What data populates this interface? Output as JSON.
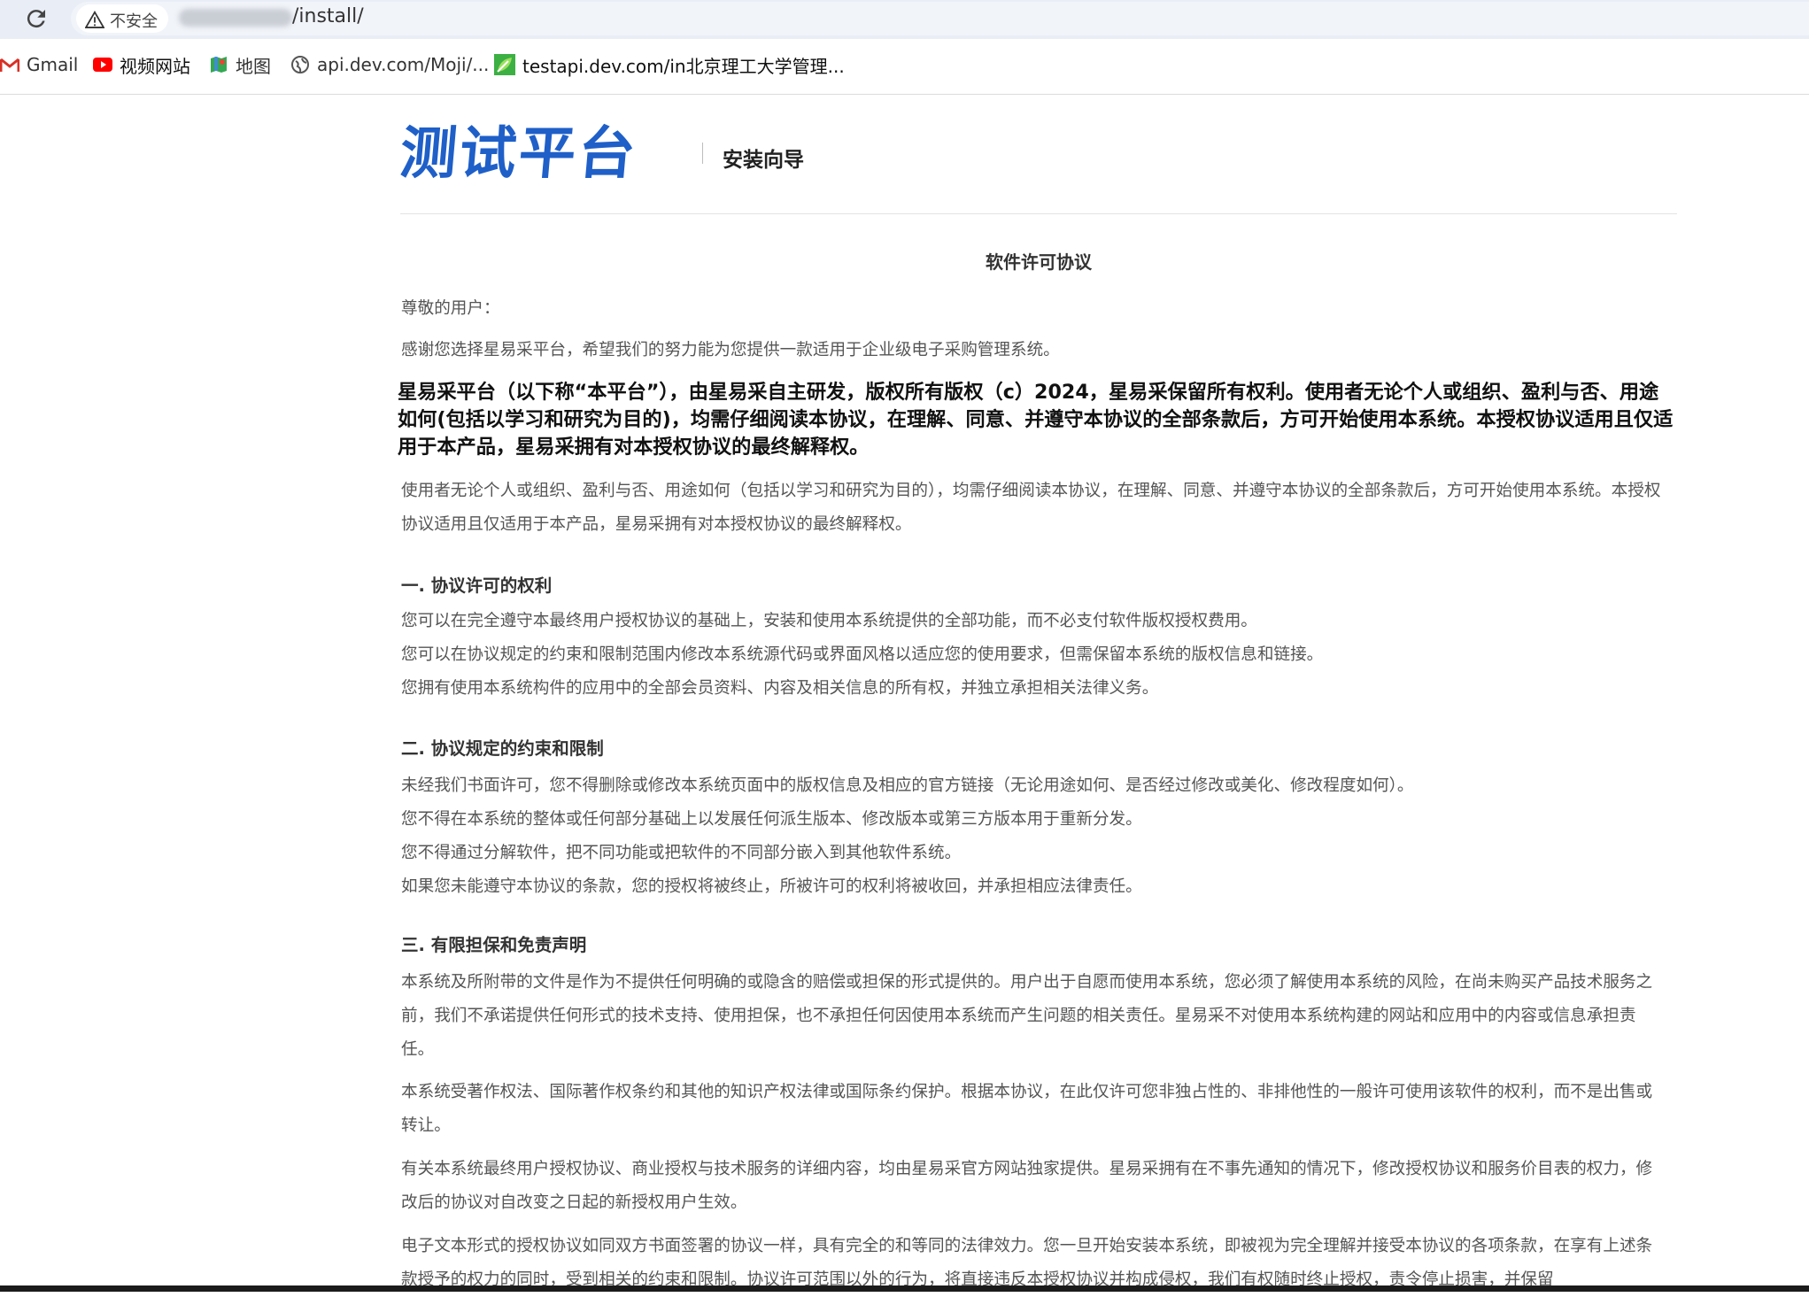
{
  "browser": {
    "security_label": "不安全",
    "url_path": "/install/",
    "bookmarks": [
      {
        "label": "Gmail",
        "icon": "gmail-icon"
      },
      {
        "label": "视频网站",
        "icon": "youtube-icon"
      },
      {
        "label": "地图",
        "icon": "maps-icon"
      },
      {
        "label": "api.dev.com/Moji/...",
        "icon": "globe-icon"
      },
      {
        "label": "testapi.dev.com/in北京理工大学管理...",
        "icon": "leaf-icon"
      }
    ]
  },
  "header": {
    "logo_text": "测试平台",
    "guide_label": "安装向导"
  },
  "doc": {
    "title": "软件许可协议",
    "greeting": "尊敬的用户：",
    "intro": "感谢您选择星易采平台，希望我们的努力能为您提供一款适用于企业级电子采购管理系统。",
    "bold_notice": "星易采平台（以下称“本平台”），由星易采自主研发，版权所有版权（c）2024，星易采保留所有权利。使用者无论个人或组织、盈利与否、用途如何(包括以学习和研究为目的)，均需仔细阅读本协议，在理解、同意、并遵守本协议的全部条款后，方可开始使用本系统。本授权协议适用且仅适用于本产品，星易采拥有对本授权协议的最终解释权。",
    "notice": "使用者无论个人或组织、盈利与否、用途如何（包括以学习和研究为目的），均需仔细阅读本协议，在理解、同意、并遵守本协议的全部条款后，方可开始使用本系统。本授权协议适用且仅适用于本产品，星易采拥有对本授权协议的最终解释权。",
    "sections": [
      {
        "heading": "一. 协议许可的权利",
        "items": [
          "您可以在完全遵守本最终用户授权协议的基础上，安装和使用本系统提供的全部功能，而不必支付软件版权授权费用。",
          "您可以在协议规定的约束和限制范围内修改本系统源代码或界面风格以适应您的使用要求，但需保留本系统的版权信息和链接。",
          "您拥有使用本系统构件的应用中的全部会员资料、内容及相关信息的所有权，并独立承担相关法律义务。"
        ]
      },
      {
        "heading": "二. 协议规定的约束和限制",
        "items": [
          "未经我们书面许可，您不得删除或修改本系统页面中的版权信息及相应的官方链接（无论用途如何、是否经过修改或美化、修改程度如何）。",
          "您不得在本系统的整体或任何部分基础上以发展任何派生版本、修改版本或第三方版本用于重新分发。",
          "您不得通过分解软件，把不同功能或把软件的不同部分嵌入到其他软件系统。",
          "如果您未能遵守本协议的条款，您的授权将被终止，所被许可的权利将被收回，并承担相应法律责任。"
        ]
      },
      {
        "heading": "三. 有限担保和免责声明",
        "paragraphs": [
          "本系统及所附带的文件是作为不提供任何明确的或隐含的赔偿或担保的形式提供的。用户出于自愿而使用本系统，您必须了解使用本系统的风险，在尚未购买产品技术服务之前，我们不承诺提供任何形式的技术支持、使用担保，也不承担任何因使用本系统而产生问题的相关责任。星易采不对使用本系统构建的网站和应用中的内容或信息承担责任。",
          "本系统受著作权法、国际著作权条约和其他的知识产权法律或国际条约保护。根据本协议，在此仅许可您非独占性的、非排他性的一般许可使用该软件的权利，而不是出售或转让。",
          "有关本系统最终用户授权协议、商业授权与技术服务的详细内容，均由星易采官方网站独家提供。星易采拥有在不事先通知的情况下，修改授权协议和服务价目表的权力，修改后的协议对自改变之日起的新授权用户生效。",
          "电子文本形式的授权协议如同双方书面签署的协议一样，具有完全的和等同的法律效力。您一旦开始安装本系统，即被视为完全理解并接受本协议的各项条款，在享有上述条款授予的权力的同时，受到相关的约束和限制。协议许可范围以外的行为，将直接违反本授权协议并构成侵权，我们有权随时终止授权，责令停止损害，并保留"
        ]
      }
    ]
  }
}
